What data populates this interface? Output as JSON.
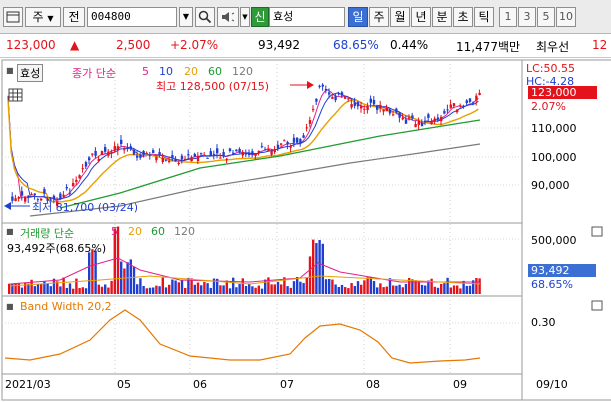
{
  "toolbar": {
    "market_label": "주",
    "jeon_label": "전",
    "code_value": "004800",
    "search_icon": "search-icon",
    "sound_icon": "speaker-icon",
    "new_badge": "신",
    "stock_name": "효성",
    "periods": [
      "일",
      "주",
      "월",
      "년",
      "분",
      "초",
      "틱"
    ],
    "intervals": [
      "1",
      "3",
      "5",
      "10"
    ],
    "selected_period": "일"
  },
  "quote": {
    "price": "123,000",
    "change": "2,500",
    "change_pct": "+2.07%",
    "volume": "93,492",
    "ratio1": "68.65%",
    "ratio2": "0.44%",
    "amount": "11,477백만",
    "pref_label": "최우선",
    "pref_value": "12"
  },
  "chart": {
    "stock_tag": "효성",
    "ma_title": "종가 단순",
    "ma_periods": [
      "5",
      "10",
      "20",
      "60",
      "120"
    ],
    "ma_colors": [
      "#e0208c",
      "#1f3fd6",
      "#e6a000",
      "#1f9a2f",
      "#7a7a7a"
    ],
    "high_annotation": "최고 128,500 (07/15)",
    "low_annotation": "최저 81,700 (03/24)",
    "lc_label": "LC:50.55",
    "hc_label": "HC:-4.28",
    "price_flag": "123,000",
    "pct_flag": "2.07%",
    "price_axis": [
      "110,000",
      "100,000",
      "90,000"
    ],
    "volume_title": "거래량 단순",
    "volume_ma_periods": [
      "5",
      "20",
      "60",
      "120"
    ],
    "volume_info": "93,492주(68.65%)",
    "volume_axis": [
      "500,000"
    ],
    "volume_flag": "93,492",
    "volume_pct_flag": "68.65%",
    "bw_title": "Band Width 20,2",
    "bw_axis": [
      "0.30"
    ],
    "date_labels": [
      "2021/03",
      "05",
      "06",
      "07",
      "08",
      "09"
    ],
    "date_right": "09/10",
    "colors": {
      "up": "#e3121b",
      "down": "#1e3fd0",
      "accent": "#3b6fd4"
    }
  }
}
